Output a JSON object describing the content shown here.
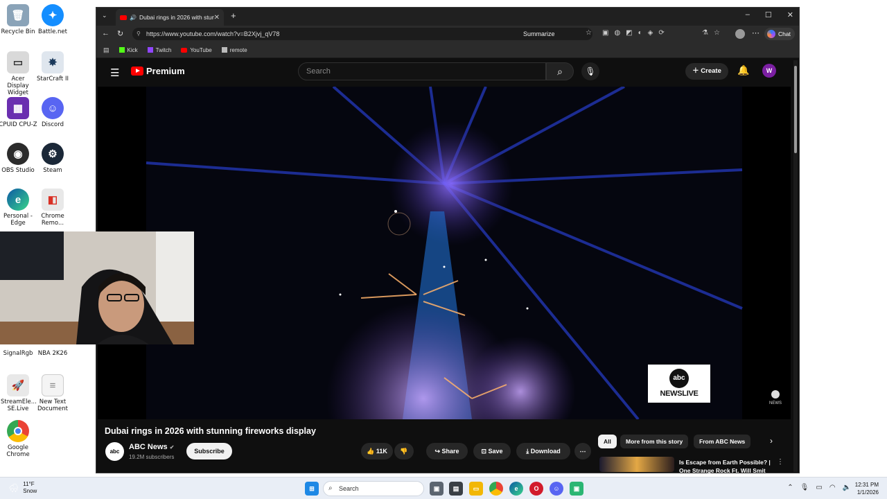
{
  "desktop": {
    "icons": [
      {
        "label": "Recycle Bin"
      },
      {
        "label": "Battle.net"
      },
      {
        "label": "Acer Display Widget"
      },
      {
        "label": "StarCraft II"
      },
      {
        "label": "CPUID CPU-Z"
      },
      {
        "label": "Discord"
      },
      {
        "label": "OBS Studio"
      },
      {
        "label": "Steam"
      },
      {
        "label": "Personal - Edge"
      },
      {
        "label": "Chrome Remo..."
      },
      {
        "label": "SignalRgb"
      },
      {
        "label": "NBA 2K26"
      },
      {
        "label": "StreamEle... SE.Live"
      },
      {
        "label": "New Text Document"
      },
      {
        "label": "Google Chrome"
      }
    ]
  },
  "browser": {
    "tab_title": "Dubai rings in 2026 with stunni",
    "url": "https://www.youtube.com/watch?v=B2Xjvj_qV78",
    "summarize_label": "Summarize",
    "chat_label": "Chat",
    "bookmarks": [
      {
        "label": "Kick",
        "color": "#53fc18"
      },
      {
        "label": "Twitch",
        "color": "#9146ff"
      },
      {
        "label": "YouTube",
        "color": "#ff0000"
      },
      {
        "label": "remote",
        "color": "#bbbbbb"
      }
    ]
  },
  "youtube": {
    "logo_text": "Premium",
    "search_placeholder": "Search",
    "create_label": "Create",
    "avatar_letter": "W",
    "video_title": "Dubai rings in 2026 with stunning fireworks display",
    "channel": {
      "avatar_text": "abc",
      "name": "ABC News",
      "subscribers": "19.2M subscribers",
      "subscribe_label": "Subscribe"
    },
    "actions": {
      "likes": "11K",
      "share": "Share",
      "save": "Save",
      "download": "Download"
    },
    "chips": [
      "All",
      "More from this story",
      "From ABC News"
    ],
    "recommendation_title": "Is Escape from Earth Possible? | One Strange Rock Ft. Will Smit",
    "player_badge": {
      "logo": "abc",
      "text": "NEWSLIVE"
    },
    "watermark": "abc NEWS"
  },
  "taskbar": {
    "weather_temp": "11°F",
    "weather_desc": "Snow",
    "search_label": "Search",
    "time": "12:31 PM",
    "date": "1/1/2026"
  },
  "colors": {
    "accent_red": "#ff0000",
    "dark_bg": "#0f0f0f"
  }
}
